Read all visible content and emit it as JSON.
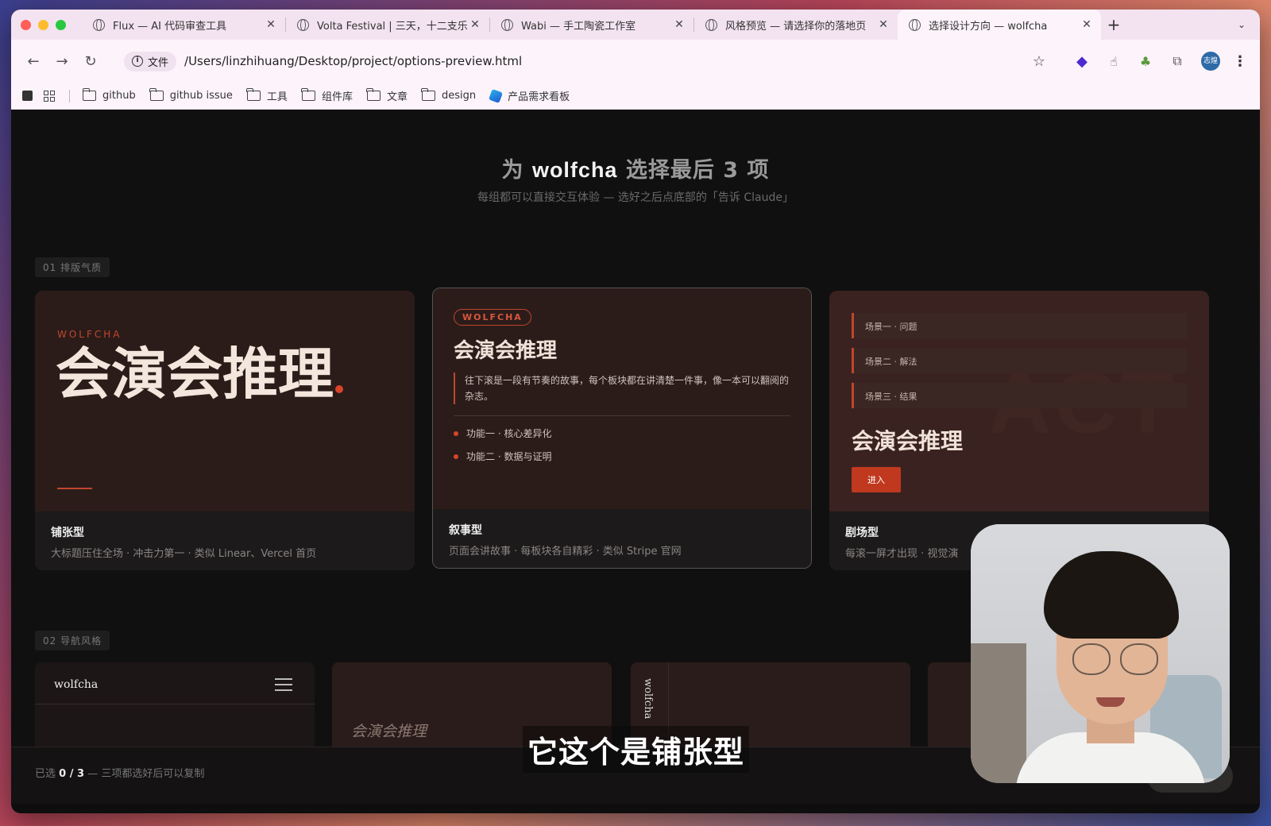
{
  "browser": {
    "tabs": [
      {
        "title": "Flux — AI 代码审查工具",
        "active": false
      },
      {
        "title": "Volta Festival | 三天，十二支乐",
        "active": false
      },
      {
        "title": "Wabi — 手工陶瓷工作室",
        "active": false
      },
      {
        "title": "风格预览 — 请选择你的落地页",
        "active": false
      },
      {
        "title": "选择设计方向 — wolfcha",
        "active": true
      }
    ],
    "new_tab": "+",
    "tab_close": "✕",
    "site_info_label": "文件",
    "url": "/Users/linzhihuang/Desktop/project/options-preview.html",
    "profile_initials": "志煌",
    "bookmarks": [
      "github",
      "github issue",
      "工具",
      "组件库",
      "文章",
      "design",
      "产品需求看板"
    ]
  },
  "page": {
    "hero_prefix": "为",
    "hero_brand": "wolfcha",
    "hero_suffix": "选择最后 3 项",
    "hero_sub": "每组都可以直接交互体验 — 选好之后点底部的「告诉 Claude」",
    "section1_tag": "01  排版气质",
    "section2_tag": "02  导航风格",
    "cards": [
      {
        "brand": "WOLFCHA",
        "headline": "会演会推理",
        "name": "铺张型",
        "desc": "大标题压住全场 · 冲击力第一 · 类似 Linear、Vercel 首页"
      },
      {
        "badge": "WOLFCHA",
        "headline": "会演会推理",
        "quote": "往下滚是一段有节奏的故事，每个板块都在讲清楚一件事，像一本可以翻阅的杂志。",
        "features": [
          "功能一 · 核心差异化",
          "功能二 · 数据与证明"
        ],
        "name": "叙事型",
        "desc": "页面会讲故事 · 每板块各自精彩 · 类似 Stripe 官网"
      },
      {
        "scenes": [
          "场景一 · 问题",
          "场景二 · 解法",
          "场景三 · 结果"
        ],
        "bg_text": "ACT",
        "headline": "会演会推理",
        "button": "进入",
        "name": "剧场型",
        "desc": "每滚一屏才出现 · 视觉演"
      }
    ],
    "nav_cards": {
      "n1_logo": "wolfcha",
      "n2_text": "会演会推理",
      "n3_vertical": "wolfcha"
    },
    "bottom": {
      "prefix": "已选",
      "count": "0 / 3",
      "suffix": "— 三项都选好后可以复制",
      "copy_button": "复制选项"
    }
  },
  "overlay": {
    "subtitle": "它这个是铺张型"
  },
  "colors": {
    "accent": "#c0462c",
    "page_bg": "#111010",
    "card_preview_bg": "#2b1c1a"
  }
}
